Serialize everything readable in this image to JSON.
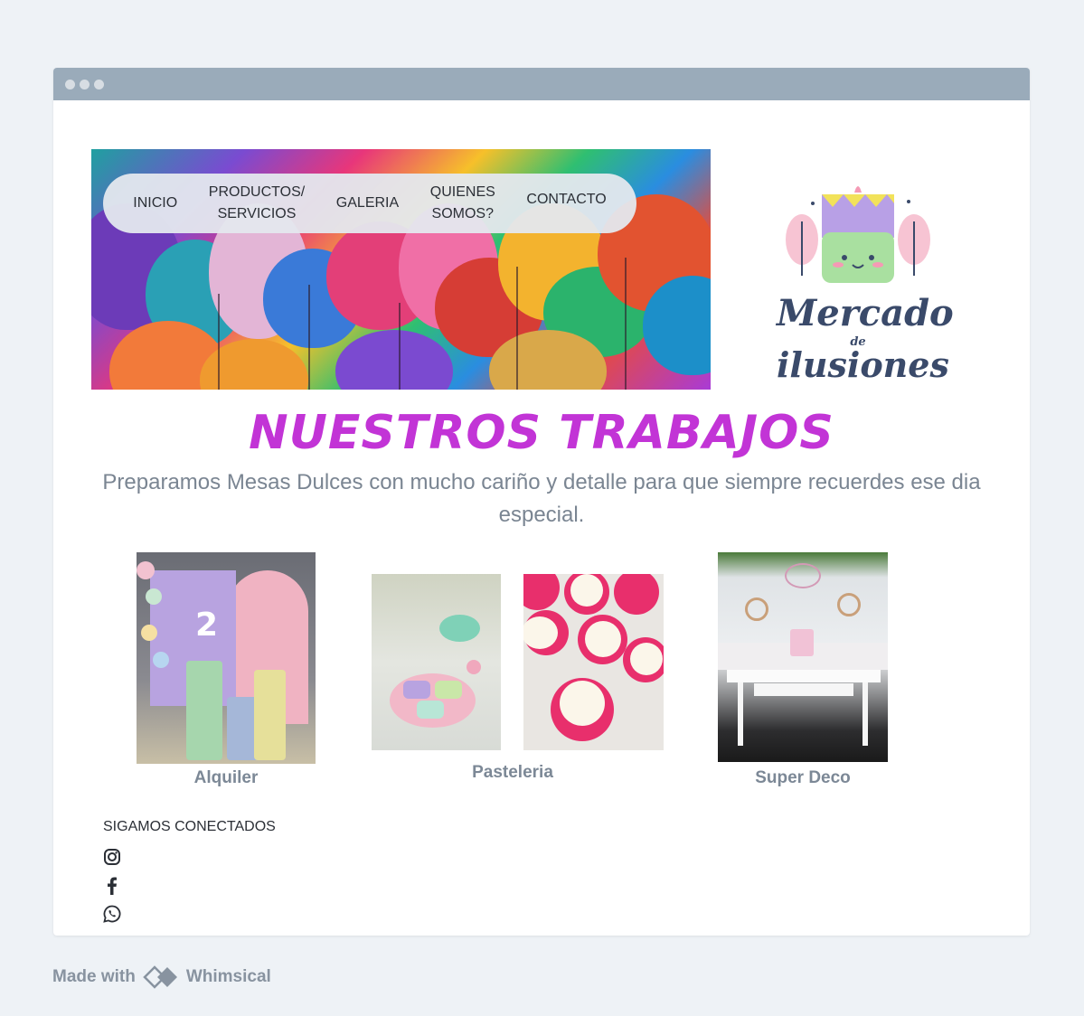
{
  "nav": {
    "items": [
      {
        "label": "INICIO"
      },
      {
        "label": "PRODUCTOS/\nSERVICIOS"
      },
      {
        "label": "GALERIA"
      },
      {
        "label": "QUIENES\nSOMOS?"
      },
      {
        "label": "CONTACTO"
      }
    ]
  },
  "logo": {
    "line1": "Mercado",
    "line2": "de",
    "line3": "ilusiones"
  },
  "main": {
    "title": "NUESTROS TRABAJOS",
    "subtitle": "Preparamos Mesas Dulces con mucho cariño y detalle para que siempre recuerdes ese dia especial."
  },
  "gallery": [
    {
      "caption": "Alquiler"
    },
    {
      "caption": "Pasteleria"
    },
    {
      "caption": "Super Deco"
    }
  ],
  "social": {
    "title": "SIGAMOS CONECTADOS",
    "icons": [
      "instagram-icon",
      "facebook-icon",
      "whatsapp-icon"
    ]
  },
  "footer": {
    "made_with": "Made with",
    "brand": "Whimsical"
  },
  "colors": {
    "accent": "#c234d6",
    "titlebar": "#9aabba"
  }
}
